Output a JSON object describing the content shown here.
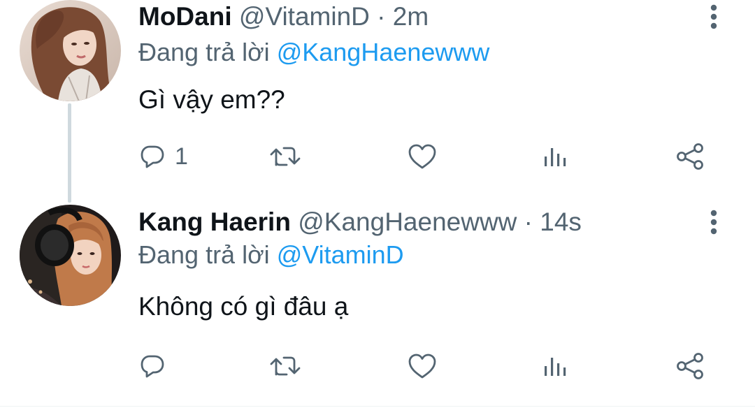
{
  "tweets": [
    {
      "name": "MoDani",
      "handle": "@VitaminD",
      "separator": "·",
      "time": "2m",
      "reply_prefix": "Đang trả lời",
      "reply_to": "@KangHaenewww",
      "text": "Gì vậy em??",
      "reply_count": "1",
      "avatar_icon": "profile-photo-woman-long-brown-hair"
    },
    {
      "name": "Kang Haerin",
      "handle": "@KangHaenewww",
      "separator": "·",
      "time": "14s",
      "reply_prefix": "Đang trả lời",
      "reply_to": "@VitaminD",
      "text": "Không có gì đâu ạ",
      "reply_count": "",
      "avatar_icon": "profile-photo-woman-headphones"
    }
  ],
  "icons": {
    "more": "vertical-ellipsis-icon",
    "reply": "reply-bubble-icon",
    "retweet": "retweet-icon",
    "like": "heart-icon",
    "views": "analytics-bars-icon",
    "share": "share-icon"
  },
  "colors": {
    "text": "#0f1419",
    "secondary": "#536471",
    "mention": "#1d9bf0",
    "thread_line": "#cfd9de"
  }
}
